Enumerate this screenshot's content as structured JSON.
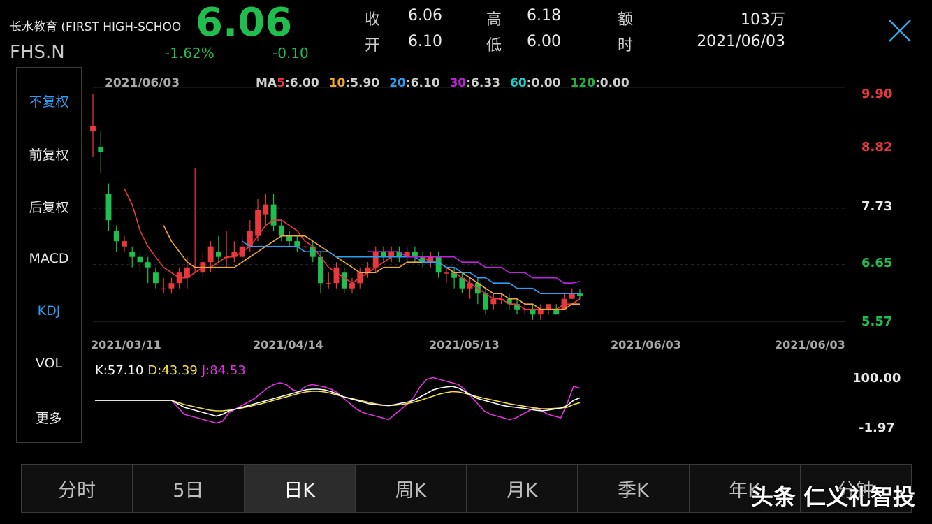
{
  "header": {
    "company_name": "长水教育 (FIRST HIGH-SCHOO",
    "ticker": "FHS.N",
    "price": "6.06",
    "change_pct": "-1.62%",
    "change": "-0.10",
    "stats": [
      {
        "label": "收",
        "value": "6.06"
      },
      {
        "label": "开",
        "value": "6.10"
      },
      {
        "label": "高",
        "value": "6.18"
      },
      {
        "label": "低",
        "value": "6.00"
      },
      {
        "label": "额",
        "value": "103万"
      },
      {
        "label": "时",
        "value": "2021/06/03"
      }
    ]
  },
  "sidebar": {
    "items": [
      {
        "label": "不复权",
        "active": true
      },
      {
        "label": "前复权",
        "active": false
      },
      {
        "label": "后复权",
        "active": false
      },
      {
        "label": "MACD",
        "active": false
      },
      {
        "label": "KDJ",
        "active": true
      },
      {
        "label": "VOL",
        "active": false
      },
      {
        "label": "更多",
        "active": false
      }
    ]
  },
  "main_chart": {
    "date": "2021/06/03",
    "ma_prefix": "MA",
    "ma": [
      {
        "period": "5",
        "value": "6.00",
        "color": "#e8383d"
      },
      {
        "period": "10",
        "value": "5.90",
        "color": "#f0a830"
      },
      {
        "period": "20",
        "value": "6.10",
        "color": "#2a9df4"
      },
      {
        "period": "30",
        "value": "6.33",
        "color": "#c020e0"
      },
      {
        "period": "60",
        "value": "0.00",
        "color": "#20c8c8"
      },
      {
        "period": "120",
        "value": "0.00",
        "color": "#20b040"
      }
    ],
    "y_ticks": [
      "9.90",
      "8.82",
      "7.73",
      "6.65",
      "5.57"
    ],
    "x_dates": [
      "2021/03/11",
      "2021/04/14",
      "2021/05/13",
      "2021/06/03",
      "2021/06/03"
    ]
  },
  "kdj": {
    "k_label": "K:57.10",
    "d_label": "D:43.39",
    "j_label": "J:84.53",
    "y_ticks": [
      "100.00",
      "-1.97"
    ]
  },
  "chart_data": {
    "type": "candlestick",
    "ylim": [
      5.57,
      9.9
    ],
    "candles": [
      [
        9.2,
        9.3,
        9.9,
        8.7
      ],
      [
        8.9,
        8.8,
        9.2,
        8.4
      ],
      [
        8.0,
        7.5,
        8.2,
        7.3
      ],
      [
        7.3,
        7.1,
        7.4,
        6.9
      ],
      [
        7.0,
        7.1,
        7.2,
        6.9
      ],
      [
        6.9,
        6.8,
        7.0,
        6.6
      ],
      [
        6.8,
        6.7,
        6.9,
        6.5
      ],
      [
        6.7,
        6.6,
        6.8,
        6.3
      ],
      [
        6.5,
        6.3,
        6.6,
        6.2
      ],
      [
        6.2,
        6.2,
        6.4,
        6.1
      ],
      [
        6.2,
        6.3,
        6.4,
        6.1
      ],
      [
        6.3,
        6.5,
        6.6,
        6.2
      ],
      [
        6.4,
        6.6,
        6.8,
        6.2
      ],
      [
        6.6,
        6.6,
        8.5,
        6.5
      ],
      [
        6.5,
        6.7,
        6.9,
        6.4
      ],
      [
        6.7,
        7.0,
        7.1,
        6.5
      ],
      [
        6.9,
        6.8,
        7.2,
        6.7
      ],
      [
        6.8,
        6.8,
        7.3,
        6.6
      ],
      [
        6.8,
        6.9,
        7.1,
        6.7
      ],
      [
        6.8,
        7.0,
        7.2,
        6.7
      ],
      [
        7.0,
        7.3,
        7.5,
        6.9
      ],
      [
        7.2,
        7.7,
        7.9,
        7.1
      ],
      [
        7.6,
        7.8,
        8.0,
        7.4
      ],
      [
        7.8,
        7.4,
        8.0,
        7.3
      ],
      [
        7.4,
        7.2,
        7.5,
        7.1
      ],
      [
        7.2,
        7.1,
        7.3,
        7.0
      ],
      [
        7.1,
        7.0,
        7.2,
        6.9
      ],
      [
        7.0,
        7.0,
        7.1,
        6.9
      ],
      [
        7.0,
        6.8,
        7.1,
        6.7
      ],
      [
        6.8,
        6.3,
        6.9,
        6.1
      ],
      [
        6.3,
        6.3,
        6.5,
        6.2
      ],
      [
        6.3,
        6.6,
        6.7,
        6.2
      ],
      [
        6.5,
        6.2,
        6.6,
        6.1
      ],
      [
        6.2,
        6.3,
        6.4,
        6.1
      ],
      [
        6.3,
        6.5,
        6.6,
        6.2
      ],
      [
        6.5,
        6.6,
        6.7,
        6.4
      ],
      [
        6.6,
        6.9,
        7.0,
        6.5
      ],
      [
        6.9,
        6.8,
        7.0,
        6.7
      ],
      [
        6.8,
        6.9,
        7.0,
        6.7
      ],
      [
        6.9,
        6.8,
        7.0,
        6.7
      ],
      [
        6.8,
        6.9,
        7.0,
        6.7
      ],
      [
        6.9,
        6.8,
        7.0,
        6.7
      ],
      [
        6.8,
        6.7,
        6.9,
        6.6
      ],
      [
        6.7,
        6.8,
        6.9,
        6.6
      ],
      [
        6.8,
        6.5,
        6.9,
        6.4
      ],
      [
        6.5,
        6.5,
        6.6,
        6.3
      ],
      [
        6.5,
        6.4,
        6.6,
        6.2
      ],
      [
        6.4,
        6.2,
        6.5,
        6.1
      ],
      [
        6.2,
        6.3,
        6.4,
        6.0
      ],
      [
        6.3,
        6.1,
        6.4,
        5.9
      ],
      [
        6.1,
        5.8,
        6.2,
        5.7
      ],
      [
        5.9,
        6.0,
        6.1,
        5.8
      ],
      [
        6.0,
        6.0,
        6.1,
        5.9
      ],
      [
        6.0,
        5.9,
        6.1,
        5.8
      ],
      [
        5.9,
        5.8,
        6.0,
        5.7
      ],
      [
        5.8,
        5.8,
        5.9,
        5.7
      ],
      [
        5.8,
        5.7,
        5.9,
        5.6
      ],
      [
        5.7,
        5.8,
        5.9,
        5.6
      ],
      [
        5.8,
        5.9,
        5.9,
        5.7
      ],
      [
        5.8,
        5.7,
        5.9,
        5.7
      ],
      [
        5.8,
        6.0,
        6.1,
        5.8
      ],
      [
        6.0,
        6.1,
        6.2,
        6.0
      ],
      [
        6.1,
        6.06,
        6.18,
        6.0
      ]
    ],
    "ma5": [
      null,
      null,
      null,
      null,
      8.1,
      7.8,
      7.3,
      7.0,
      6.8,
      6.6,
      6.5,
      6.4,
      6.4,
      6.5,
      6.6,
      6.6,
      6.7,
      6.8,
      6.8,
      6.9,
      7.0,
      7.2,
      7.4,
      7.5,
      7.5,
      7.4,
      7.3,
      7.1,
      7.0,
      6.8,
      6.6,
      6.5,
      6.4,
      6.3,
      6.4,
      6.5,
      6.6,
      6.7,
      6.8,
      6.8,
      6.8,
      6.8,
      6.8,
      6.7,
      6.7,
      6.6,
      6.5,
      6.4,
      6.3,
      6.2,
      6.1,
      6.0,
      6.0,
      5.9,
      5.9,
      5.8,
      5.8,
      5.8,
      5.8,
      5.8,
      5.9,
      5.9,
      6.0
    ],
    "ma10": [
      null,
      null,
      null,
      null,
      null,
      null,
      null,
      null,
      null,
      7.4,
      7.1,
      6.9,
      6.7,
      6.6,
      6.6,
      6.6,
      6.6,
      6.6,
      6.6,
      6.7,
      6.8,
      6.9,
      7.0,
      7.1,
      7.2,
      7.2,
      7.2,
      7.2,
      7.1,
      7.0,
      6.9,
      6.8,
      6.7,
      6.6,
      6.5,
      6.5,
      6.5,
      6.6,
      6.6,
      6.6,
      6.7,
      6.7,
      6.7,
      6.7,
      6.7,
      6.6,
      6.5,
      6.5,
      6.4,
      6.3,
      6.2,
      6.1,
      6.1,
      6.0,
      6.0,
      5.9,
      5.9,
      5.8,
      5.8,
      5.8,
      5.8,
      5.9,
      5.9
    ],
    "ma20": [
      null,
      null,
      null,
      null,
      null,
      null,
      null,
      null,
      null,
      null,
      null,
      null,
      null,
      null,
      null,
      null,
      null,
      null,
      null,
      7.1,
      7.0,
      7.0,
      7.0,
      7.0,
      7.0,
      7.0,
      7.0,
      6.9,
      6.9,
      6.9,
      6.9,
      6.8,
      6.8,
      6.8,
      6.8,
      6.8,
      6.8,
      6.8,
      6.8,
      6.8,
      6.8,
      6.8,
      6.7,
      6.7,
      6.7,
      6.6,
      6.6,
      6.5,
      6.5,
      6.4,
      6.4,
      6.3,
      6.3,
      6.3,
      6.2,
      6.2,
      6.2,
      6.1,
      6.1,
      6.1,
      6.1,
      6.1,
      6.1
    ],
    "ma30": [
      null,
      null,
      null,
      null,
      null,
      null,
      null,
      null,
      null,
      null,
      null,
      null,
      null,
      null,
      null,
      null,
      null,
      null,
      null,
      null,
      null,
      null,
      null,
      null,
      null,
      null,
      null,
      null,
      null,
      null,
      null,
      null,
      null,
      null,
      null,
      6.9,
      6.9,
      6.9,
      6.9,
      6.9,
      6.8,
      6.8,
      6.8,
      6.8,
      6.8,
      6.8,
      6.8,
      6.7,
      6.7,
      6.7,
      6.6,
      6.6,
      6.6,
      6.5,
      6.5,
      6.5,
      6.4,
      6.4,
      6.4,
      6.4,
      6.3,
      6.3,
      6.33
    ],
    "kdj": {
      "ylim": [
        -20,
        120
      ],
      "K": [
        50,
        50,
        50,
        50,
        50,
        50,
        50,
        50,
        50,
        50,
        50,
        50,
        50,
        40,
        30,
        25,
        20,
        15,
        10,
        5,
        10,
        20,
        25,
        30,
        35,
        40,
        45,
        50,
        55,
        60,
        65,
        70,
        75,
        80,
        82,
        82,
        80,
        75,
        68,
        60,
        55,
        50,
        45,
        40,
        38,
        36,
        35,
        38,
        42,
        45,
        50,
        60,
        70,
        80,
        85,
        88,
        90,
        85,
        75,
        65,
        55,
        50,
        45,
        40,
        35,
        32,
        30,
        28,
        25,
        22,
        20,
        22,
        25,
        28,
        35,
        50,
        57.1
      ],
      "D": [
        50,
        50,
        50,
        50,
        50,
        50,
        50,
        50,
        50,
        50,
        50,
        50,
        50,
        44,
        38,
        34,
        30,
        26,
        22,
        20,
        20,
        22,
        25,
        28,
        32,
        36,
        40,
        45,
        50,
        55,
        60,
        65,
        70,
        74,
        76,
        76,
        74,
        70,
        65,
        60,
        56,
        52,
        48,
        44,
        40,
        37,
        35,
        36,
        38,
        41,
        45,
        50,
        56,
        62,
        68,
        72,
        75,
        74,
        70,
        65,
        60,
        56,
        52,
        48,
        44,
        40,
        37,
        34,
        31,
        28,
        26,
        26,
        27,
        28,
        30,
        38,
        43.39
      ],
      "J": [
        50,
        50,
        50,
        50,
        50,
        50,
        50,
        50,
        50,
        50,
        50,
        50,
        50,
        30,
        10,
        5,
        0,
        -5,
        -10,
        -15,
        -10,
        15,
        25,
        35,
        45,
        55,
        70,
        85,
        95,
        100,
        95,
        80,
        75,
        90,
        95,
        92,
        88,
        82,
        72,
        55,
        40,
        25,
        15,
        10,
        5,
        0,
        -5,
        10,
        25,
        40,
        60,
        90,
        110,
        115,
        110,
        105,
        100,
        95,
        80,
        60,
        40,
        20,
        10,
        5,
        0,
        -5,
        0,
        10,
        20,
        30,
        20,
        10,
        5,
        0,
        40,
        90,
        84.53
      ]
    }
  }
}
